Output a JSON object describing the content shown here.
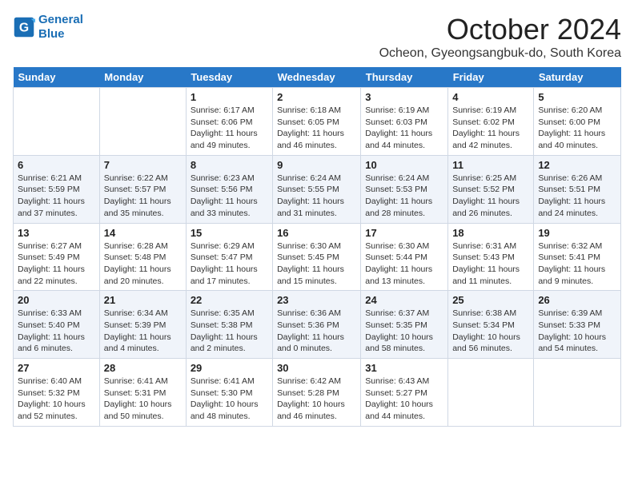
{
  "logo": {
    "line1": "General",
    "line2": "Blue"
  },
  "title": "October 2024",
  "location": "Ocheon, Gyeongsangbuk-do, South Korea",
  "weekdays": [
    "Sunday",
    "Monday",
    "Tuesday",
    "Wednesday",
    "Thursday",
    "Friday",
    "Saturday"
  ],
  "weeks": [
    [
      {
        "day": "",
        "detail": ""
      },
      {
        "day": "",
        "detail": ""
      },
      {
        "day": "1",
        "detail": "Sunrise: 6:17 AM\nSunset: 6:06 PM\nDaylight: 11 hours and 49 minutes."
      },
      {
        "day": "2",
        "detail": "Sunrise: 6:18 AM\nSunset: 6:05 PM\nDaylight: 11 hours and 46 minutes."
      },
      {
        "day": "3",
        "detail": "Sunrise: 6:19 AM\nSunset: 6:03 PM\nDaylight: 11 hours and 44 minutes."
      },
      {
        "day": "4",
        "detail": "Sunrise: 6:19 AM\nSunset: 6:02 PM\nDaylight: 11 hours and 42 minutes."
      },
      {
        "day": "5",
        "detail": "Sunrise: 6:20 AM\nSunset: 6:00 PM\nDaylight: 11 hours and 40 minutes."
      }
    ],
    [
      {
        "day": "6",
        "detail": "Sunrise: 6:21 AM\nSunset: 5:59 PM\nDaylight: 11 hours and 37 minutes."
      },
      {
        "day": "7",
        "detail": "Sunrise: 6:22 AM\nSunset: 5:57 PM\nDaylight: 11 hours and 35 minutes."
      },
      {
        "day": "8",
        "detail": "Sunrise: 6:23 AM\nSunset: 5:56 PM\nDaylight: 11 hours and 33 minutes."
      },
      {
        "day": "9",
        "detail": "Sunrise: 6:24 AM\nSunset: 5:55 PM\nDaylight: 11 hours and 31 minutes."
      },
      {
        "day": "10",
        "detail": "Sunrise: 6:24 AM\nSunset: 5:53 PM\nDaylight: 11 hours and 28 minutes."
      },
      {
        "day": "11",
        "detail": "Sunrise: 6:25 AM\nSunset: 5:52 PM\nDaylight: 11 hours and 26 minutes."
      },
      {
        "day": "12",
        "detail": "Sunrise: 6:26 AM\nSunset: 5:51 PM\nDaylight: 11 hours and 24 minutes."
      }
    ],
    [
      {
        "day": "13",
        "detail": "Sunrise: 6:27 AM\nSunset: 5:49 PM\nDaylight: 11 hours and 22 minutes."
      },
      {
        "day": "14",
        "detail": "Sunrise: 6:28 AM\nSunset: 5:48 PM\nDaylight: 11 hours and 20 minutes."
      },
      {
        "day": "15",
        "detail": "Sunrise: 6:29 AM\nSunset: 5:47 PM\nDaylight: 11 hours and 17 minutes."
      },
      {
        "day": "16",
        "detail": "Sunrise: 6:30 AM\nSunset: 5:45 PM\nDaylight: 11 hours and 15 minutes."
      },
      {
        "day": "17",
        "detail": "Sunrise: 6:30 AM\nSunset: 5:44 PM\nDaylight: 11 hours and 13 minutes."
      },
      {
        "day": "18",
        "detail": "Sunrise: 6:31 AM\nSunset: 5:43 PM\nDaylight: 11 hours and 11 minutes."
      },
      {
        "day": "19",
        "detail": "Sunrise: 6:32 AM\nSunset: 5:41 PM\nDaylight: 11 hours and 9 minutes."
      }
    ],
    [
      {
        "day": "20",
        "detail": "Sunrise: 6:33 AM\nSunset: 5:40 PM\nDaylight: 11 hours and 6 minutes."
      },
      {
        "day": "21",
        "detail": "Sunrise: 6:34 AM\nSunset: 5:39 PM\nDaylight: 11 hours and 4 minutes."
      },
      {
        "day": "22",
        "detail": "Sunrise: 6:35 AM\nSunset: 5:38 PM\nDaylight: 11 hours and 2 minutes."
      },
      {
        "day": "23",
        "detail": "Sunrise: 6:36 AM\nSunset: 5:36 PM\nDaylight: 11 hours and 0 minutes."
      },
      {
        "day": "24",
        "detail": "Sunrise: 6:37 AM\nSunset: 5:35 PM\nDaylight: 10 hours and 58 minutes."
      },
      {
        "day": "25",
        "detail": "Sunrise: 6:38 AM\nSunset: 5:34 PM\nDaylight: 10 hours and 56 minutes."
      },
      {
        "day": "26",
        "detail": "Sunrise: 6:39 AM\nSunset: 5:33 PM\nDaylight: 10 hours and 54 minutes."
      }
    ],
    [
      {
        "day": "27",
        "detail": "Sunrise: 6:40 AM\nSunset: 5:32 PM\nDaylight: 10 hours and 52 minutes."
      },
      {
        "day": "28",
        "detail": "Sunrise: 6:41 AM\nSunset: 5:31 PM\nDaylight: 10 hours and 50 minutes."
      },
      {
        "day": "29",
        "detail": "Sunrise: 6:41 AM\nSunset: 5:30 PM\nDaylight: 10 hours and 48 minutes."
      },
      {
        "day": "30",
        "detail": "Sunrise: 6:42 AM\nSunset: 5:28 PM\nDaylight: 10 hours and 46 minutes."
      },
      {
        "day": "31",
        "detail": "Sunrise: 6:43 AM\nSunset: 5:27 PM\nDaylight: 10 hours and 44 minutes."
      },
      {
        "day": "",
        "detail": ""
      },
      {
        "day": "",
        "detail": ""
      }
    ]
  ]
}
